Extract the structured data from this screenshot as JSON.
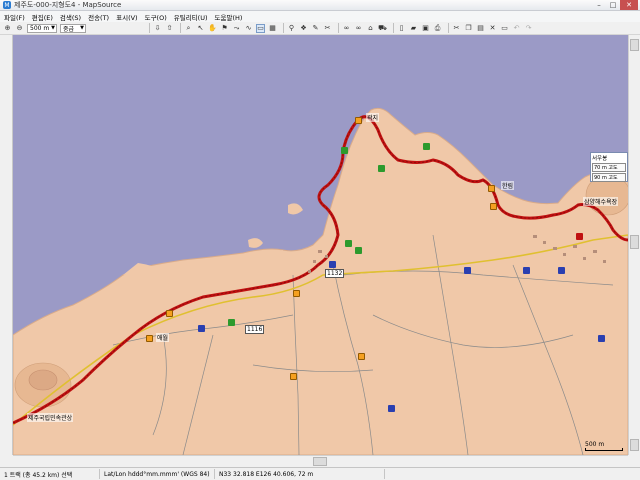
{
  "window": {
    "title": "제주도-000-지형도4 - MapSource",
    "minimize": "–",
    "maximize": "□",
    "close": "✕"
  },
  "menu": [
    "파일(F)",
    "편집(E)",
    "검색(S)",
    "전송(T)",
    "표시(V)",
    "도구(O)",
    "유틸리티(U)",
    "도움말(H)"
  ],
  "toolbar": {
    "scale_combo": "500 m",
    "detail_combo": "중급"
  },
  "map": {
    "labels": {
      "gwakji": "곽지",
      "hangreang": "한림",
      "aewol": "애월",
      "geumneung": "협재",
      "seoubong": "삼양해수욕장",
      "jeju_park": "제주국립민속관상",
      "route_num": "1132",
      "route_num2": "1116"
    },
    "elevation_panel": {
      "title": "서우봉",
      "row1": "70 m  고도",
      "row2": "90 m  고도"
    },
    "scale_text": "500 m"
  },
  "status": {
    "track": "1 트랙 (총 45.2 km) 선택",
    "format": "Lat/Lon hddd°mm.mmm' (WGS 84)",
    "coords": "N33 32.818 E126 40.606, 72 m"
  }
}
